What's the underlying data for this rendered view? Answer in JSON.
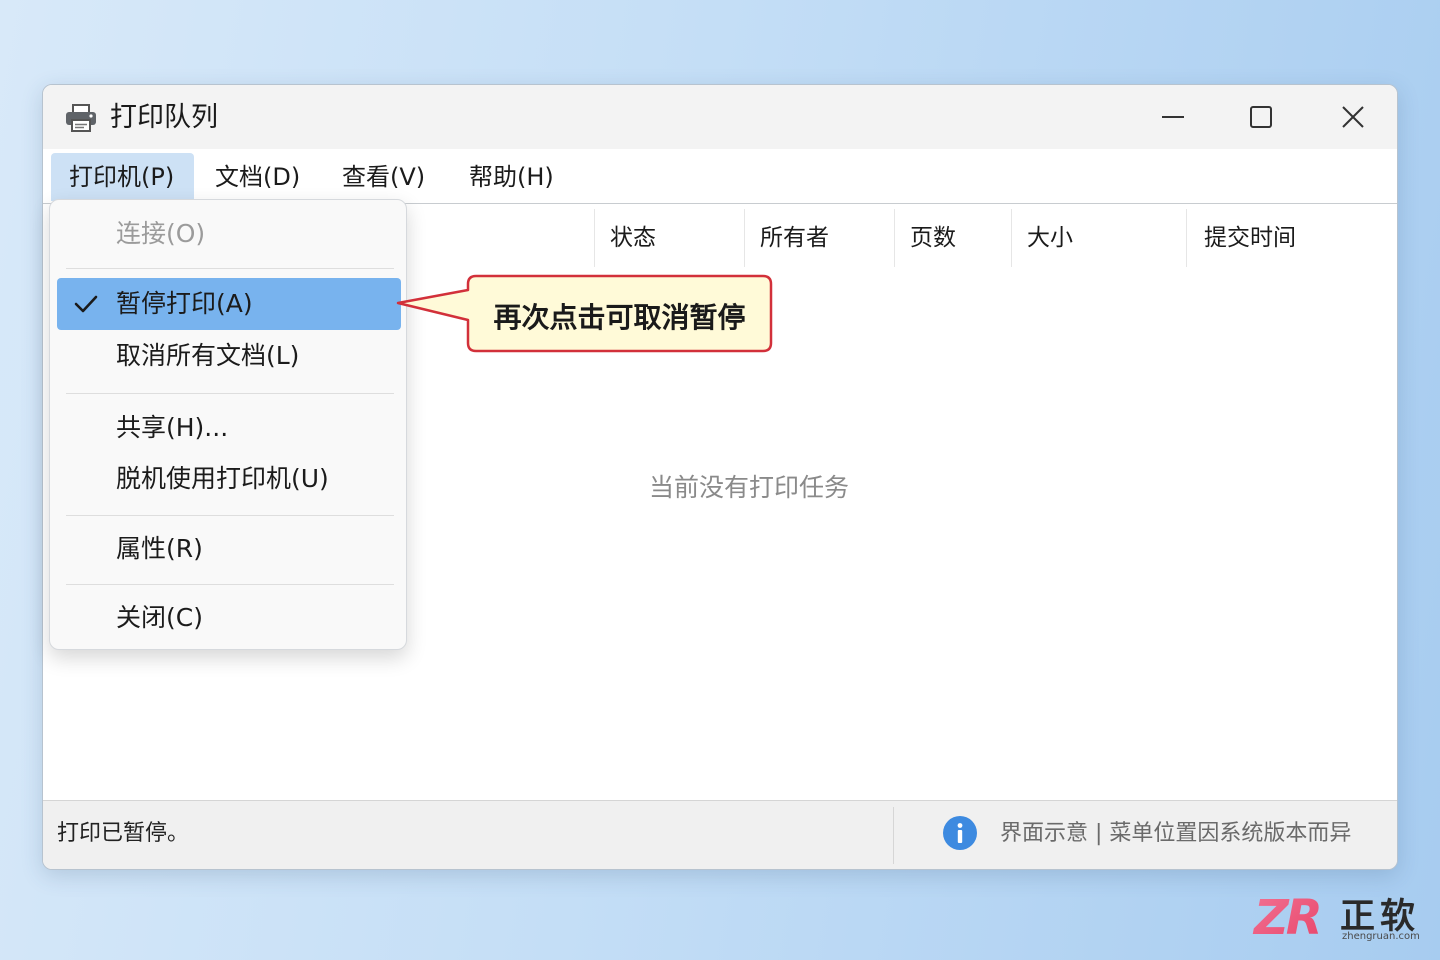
{
  "window": {
    "title": "打印队列",
    "icons": {
      "app": "printer-icon",
      "minimize": "minimize-icon",
      "maximize": "maximize-icon",
      "close": "close-icon"
    }
  },
  "menubar": {
    "items": [
      {
        "label": "打印机(P)",
        "open": true
      },
      {
        "label": "文档(D)"
      },
      {
        "label": "查看(V)"
      },
      {
        "label": "帮助(H)"
      }
    ]
  },
  "printer_menu": {
    "check_icon": "checkmark-icon",
    "items": [
      {
        "label": "连接(O)",
        "enabled": false
      },
      {
        "label": "暂停打印(A)",
        "checked": true,
        "highlighted": true
      },
      {
        "label": "取消所有文档(L)"
      },
      {
        "label": "共享(H)..."
      },
      {
        "label": "脱机使用打印机(U)"
      },
      {
        "label": "属性(R)"
      },
      {
        "label": "关闭(C)"
      }
    ]
  },
  "queue": {
    "columns": [
      "状态",
      "所有者",
      "页数",
      "大小",
      "提交时间"
    ],
    "empty_message": "当前没有打印任务"
  },
  "callout": {
    "text": "再次点击可取消暂停"
  },
  "statusbar": {
    "status": "打印已暂停。",
    "info_icon": "info-icon",
    "note": "界面示意 | 菜单位置因系统版本而异"
  },
  "logo": {
    "mark": "ZR",
    "name": "正软",
    "domain": "zhengruan.com"
  },
  "colors": {
    "menu_highlight": "#78b3ee",
    "menubar_active": "#cde1f5",
    "callout_border": "#d2303a",
    "callout_fill": "#fffad8",
    "info_blue": "#3d8ae0",
    "logo_accent": "#e8456a"
  }
}
